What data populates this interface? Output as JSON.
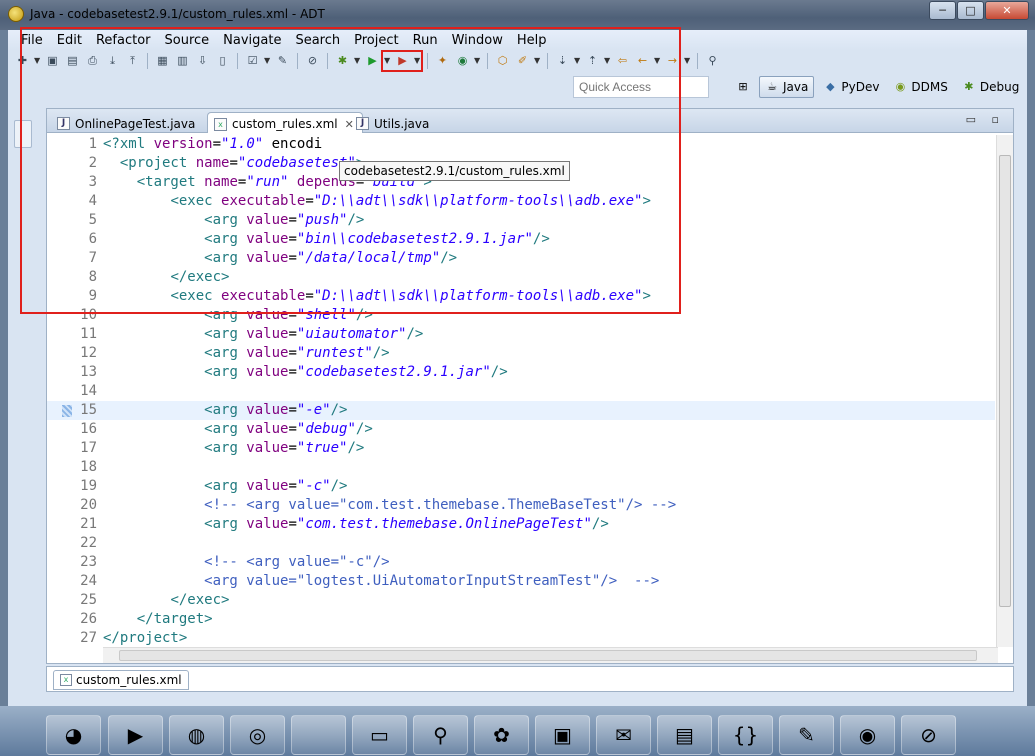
{
  "window": {
    "title": "Java - codebasetest2.9.1/custom_rules.xml - ADT",
    "minimize_label": "─",
    "maximize_label": "□",
    "close_label": "✕"
  },
  "menu": [
    "File",
    "Edit",
    "Refactor",
    "Source",
    "Navigate",
    "Search",
    "Project",
    "Run",
    "Window",
    "Help"
  ],
  "quick_access": {
    "placeholder": "Quick Access"
  },
  "perspectives": [
    {
      "label": "Java",
      "active": true,
      "icon": "java-perspective-icon"
    },
    {
      "label": "PyDev",
      "active": false,
      "icon": "python-icon"
    },
    {
      "label": "DDMS",
      "active": false,
      "icon": "android-icon"
    },
    {
      "label": "Debug",
      "active": false,
      "icon": "bug-icon"
    }
  ],
  "editor_tabs": [
    {
      "label": "OnlinePageTest.java",
      "active": false
    },
    {
      "label": "custom_rules.xml",
      "active": true
    },
    {
      "label": "Utils.java",
      "active": false
    }
  ],
  "tooltip": "codebasetest2.9.1/custom_rules.xml",
  "code_lines": [
    "<?xml version=\"1.0\" encodi",
    "  <project name=\"codebasetest\">",
    "    <target name=\"run\" depends=\"build\">",
    "        <exec executable=\"D:\\\\adt\\\\sdk\\\\platform-tools\\\\adb.exe\">",
    "            <arg value=\"push\"/>",
    "            <arg value=\"bin\\\\codebasetest2.9.1.jar\"/>",
    "            <arg value=\"/data/local/tmp\"/>",
    "        </exec>",
    "        <exec executable=\"D:\\\\adt\\\\sdk\\\\platform-tools\\\\adb.exe\">",
    "            <arg value=\"shell\"/>",
    "            <arg value=\"uiautomator\"/>",
    "            <arg value=\"runtest\"/>",
    "            <arg value=\"codebasetest2.9.1.jar\"/>",
    "",
    "            <arg value=\"-e\"/>",
    "            <arg value=\"debug\"/>",
    "            <arg value=\"true\"/>",
    "",
    "            <arg value=\"-c\"/>",
    "            <!-- <arg value=\"com.test.themebase.ThemeBaseTest\"/> -->",
    "            <arg value=\"com.test.themebase.OnlinePageTest\"/>",
    "",
    "            <!-- <arg value=\"-c\"/>",
    "            <arg value=\"logtest.UiAutomatorInputStreamTest\"/>  -->",
    "        </exec>",
    "    </target>",
    "</project>"
  ],
  "current_line": 15,
  "bottom_tab": "custom_rules.xml",
  "taskbar_items": [
    "start-orb",
    "media-player",
    "chat-app",
    "chrome",
    "blank",
    "terminal",
    "search-tool",
    "android-sdk",
    "android-device",
    "mail",
    "file-explorer",
    "json-editor",
    "notepad",
    "weibo",
    "network-disabled"
  ]
}
